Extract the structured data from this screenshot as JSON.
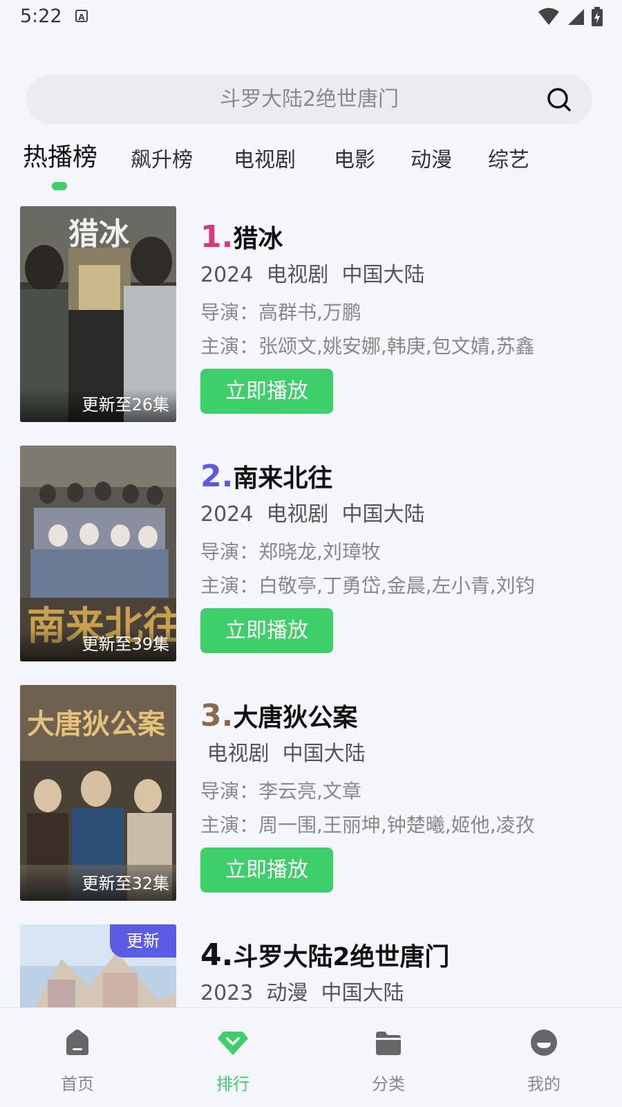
{
  "status_bar": {
    "time": "5:22",
    "indicator": "A"
  },
  "search": {
    "placeholder": "斗罗大陆2绝世唐门"
  },
  "tabs": [
    {
      "label": "热播榜",
      "active": true
    },
    {
      "label": "飙升榜",
      "active": false
    },
    {
      "label": "电视剧",
      "active": false
    },
    {
      "label": "电影",
      "active": false
    },
    {
      "label": "动漫",
      "active": false
    },
    {
      "label": "综艺",
      "active": false
    }
  ],
  "items": [
    {
      "rank": "1.",
      "rank_color": "#d8397e",
      "title": "猎冰",
      "meta": "2024  电视剧  中国大陆",
      "director": "导演：高群书,万鹏",
      "actors": "主演：张颂文,姚安娜,韩庚,包文婧,苏鑫",
      "episodes": "更新至26集",
      "play_label": "立即播放"
    },
    {
      "rank": "2.",
      "rank_color": "#5b5be6",
      "title": "南来北往",
      "meta": "2024  电视剧  中国大陆",
      "director": "导演：郑晓龙,刘璋牧",
      "actors": "主演：白敬亭,丁勇岱,金晨,左小青,刘钧",
      "episodes": "更新至39集",
      "play_label": "立即播放"
    },
    {
      "rank": "3.",
      "rank_color": "#8a6a4e",
      "title": "大唐狄公案",
      "meta": " 电视剧  中国大陆",
      "director": "导演：李云亮,文章",
      "actors": "主演：周一围,王丽坤,钟楚曦,姬他,凌孜",
      "episodes": "更新至32集",
      "play_label": "立即播放"
    },
    {
      "rank": "4.",
      "rank_color": "#111111",
      "title": "斗罗大陆2绝世唐门",
      "meta": "2023  动漫  中国大陆",
      "badge": "更新"
    }
  ],
  "bottom_nav": [
    {
      "label": "首页",
      "icon": "home-icon",
      "active": false
    },
    {
      "label": "排行",
      "icon": "rank-icon",
      "active": true
    },
    {
      "label": "分类",
      "icon": "folder-icon",
      "active": false
    },
    {
      "label": "我的",
      "icon": "profile-icon",
      "active": false
    }
  ],
  "colors": {
    "accent": "#3ecf6a",
    "badge": "#5b5be6",
    "background": "#f5f6fb"
  }
}
